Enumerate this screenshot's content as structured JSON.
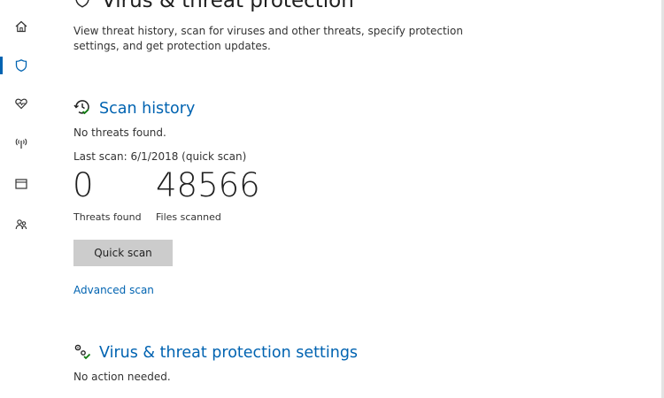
{
  "header": {
    "title": "Virus & threat protection",
    "icon": "shield-icon"
  },
  "intro": {
    "text": "View threat history, scan for viruses and other threats, specify protection settings, and get protection updates."
  },
  "nav": {
    "items": [
      {
        "icon": "home-icon",
        "active": false
      },
      {
        "icon": "shield-icon",
        "active": true
      },
      {
        "icon": "heart-health-icon",
        "active": false
      },
      {
        "icon": "wifi-antenna-icon",
        "active": false
      },
      {
        "icon": "app-browser-icon",
        "active": false
      },
      {
        "icon": "family-icon",
        "active": false
      }
    ],
    "accent_color": "#0063b1"
  },
  "scan_history": {
    "title": "Scan history",
    "icon": "clock-check-icon",
    "status": "No threats found.",
    "last_scan": "Last scan: 6/1/2018 (quick scan)",
    "threats_found_value": "0",
    "threats_found_label": "Threats found",
    "files_scanned_value": "48566",
    "files_scanned_label": "Files scanned",
    "quick_scan_label": "Quick scan",
    "advanced_scan_label": "Advanced scan"
  },
  "settings_section": {
    "title": "Virus & threat protection settings",
    "icon": "gears-check-icon",
    "status": "No action needed."
  },
  "colors": {
    "link": "#0063b1",
    "button_bg": "#cccccc",
    "status_ok": "#107c10"
  }
}
